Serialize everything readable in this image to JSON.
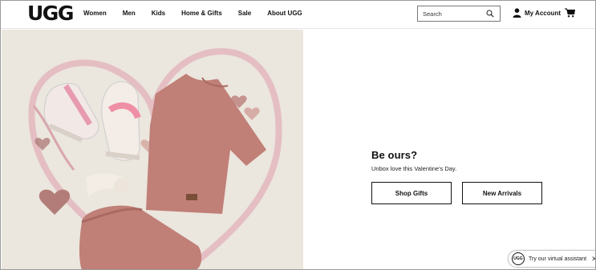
{
  "brand": {
    "logo_text": "UGG"
  },
  "nav": {
    "items": [
      {
        "label": "Women"
      },
      {
        "label": "Men"
      },
      {
        "label": "Kids"
      },
      {
        "label": "Home & Gifts"
      },
      {
        "label": "Sale"
      },
      {
        "label": "About UGG"
      }
    ]
  },
  "search": {
    "placeholder": "Search",
    "icon": "search-icon"
  },
  "account": {
    "label": "My Account",
    "icon": "user-icon"
  },
  "cart": {
    "icon": "cart-icon"
  },
  "hero": {
    "title": "Be ours?",
    "subtitle": "Unbox love this Valentine's Day.",
    "buttons": [
      {
        "label": "Shop Gifts"
      },
      {
        "label": "New Arrivals"
      }
    ],
    "image": {
      "icon": "product-photo",
      "background": "#ebe6de",
      "accent": "#c07f77",
      "ribbon": "#e3b9c0"
    }
  },
  "assistant": {
    "label": "Try our virtual assistant",
    "close": "✕",
    "icon_text": "UGG"
  }
}
